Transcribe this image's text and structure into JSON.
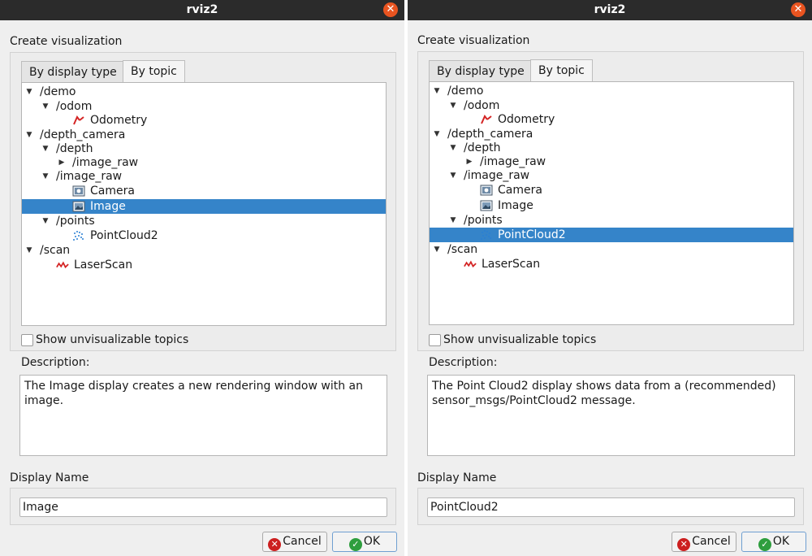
{
  "windows": [
    {
      "title": "rviz2",
      "create_label": "Create visualization",
      "tabs": [
        {
          "label": "By display type"
        },
        {
          "label": "By topic"
        }
      ],
      "tree": [
        {
          "level": 0,
          "kind": "expanded",
          "icon": "",
          "label": "/demo"
        },
        {
          "level": 1,
          "kind": "expanded",
          "icon": "",
          "label": "/odom"
        },
        {
          "level": 2,
          "kind": "leaf",
          "icon": "odometry-icon",
          "label": "Odometry"
        },
        {
          "level": 0,
          "kind": "expanded",
          "icon": "",
          "label": "/depth_camera"
        },
        {
          "level": 1,
          "kind": "expanded",
          "icon": "",
          "label": "/depth"
        },
        {
          "level": 2,
          "kind": "collapsed",
          "icon": "",
          "label": "/image_raw"
        },
        {
          "level": 1,
          "kind": "expanded",
          "icon": "",
          "label": "/image_raw"
        },
        {
          "level": 2,
          "kind": "leaf",
          "icon": "camera-icon",
          "label": "Camera"
        },
        {
          "level": 2,
          "kind": "leaf",
          "icon": "image-icon",
          "label": "Image",
          "selected": true
        },
        {
          "level": 1,
          "kind": "expanded",
          "icon": "",
          "label": "/points"
        },
        {
          "level": 2,
          "kind": "leaf",
          "icon": "pointcloud-icon",
          "label": "PointCloud2"
        },
        {
          "level": 0,
          "kind": "expanded",
          "icon": "",
          "label": "/scan"
        },
        {
          "level": 1,
          "kind": "leaf",
          "icon": "laserscan-icon",
          "label": "LaserScan"
        }
      ],
      "show_unvisualizable": "Show unvisualizable topics",
      "description_label": "Description:",
      "description": "The Image display creates a new rendering window with an image.",
      "display_name_label": "Display Name",
      "display_name_value": "Image",
      "cancel_label": "Cancel",
      "ok_label": "OK"
    },
    {
      "title": "rviz2",
      "create_label": "Create visualization",
      "tabs": [
        {
          "label": "By display type"
        },
        {
          "label": "By topic"
        }
      ],
      "tree": [
        {
          "level": 0,
          "kind": "expanded",
          "icon": "",
          "label": "/demo"
        },
        {
          "level": 1,
          "kind": "expanded",
          "icon": "",
          "label": "/odom"
        },
        {
          "level": 2,
          "kind": "leaf",
          "icon": "odometry-icon",
          "label": "Odometry"
        },
        {
          "level": 0,
          "kind": "expanded",
          "icon": "",
          "label": "/depth_camera"
        },
        {
          "level": 1,
          "kind": "expanded",
          "icon": "",
          "label": "/depth"
        },
        {
          "level": 2,
          "kind": "collapsed",
          "icon": "",
          "label": "/image_raw"
        },
        {
          "level": 1,
          "kind": "expanded",
          "icon": "",
          "label": "/image_raw"
        },
        {
          "level": 2,
          "kind": "leaf",
          "icon": "camera-icon",
          "label": "Camera"
        },
        {
          "level": 2,
          "kind": "leaf",
          "icon": "image-icon",
          "label": "Image"
        },
        {
          "level": 1,
          "kind": "expanded",
          "icon": "",
          "label": "/points"
        },
        {
          "level": 2,
          "kind": "leaf",
          "icon": "pointcloud-icon",
          "label": "PointCloud2",
          "selected": true
        },
        {
          "level": 0,
          "kind": "expanded",
          "icon": "",
          "label": "/scan"
        },
        {
          "level": 1,
          "kind": "leaf",
          "icon": "laserscan-icon",
          "label": "LaserScan"
        }
      ],
      "show_unvisualizable": "Show unvisualizable topics",
      "description_label": "Description:",
      "description": "The Point Cloud2 display shows data from a (recommended) sensor_msgs/PointCloud2 message.",
      "display_name_label": "Display Name",
      "display_name_value": "PointCloud2",
      "cancel_label": "Cancel",
      "ok_label": "OK"
    }
  ],
  "colors": {
    "titlebar": "#2b2b2b",
    "close": "#e95420",
    "selection": "#3584c9",
    "cancel_icon": "#cc1f1f",
    "ok_icon": "#2e9e3e"
  }
}
